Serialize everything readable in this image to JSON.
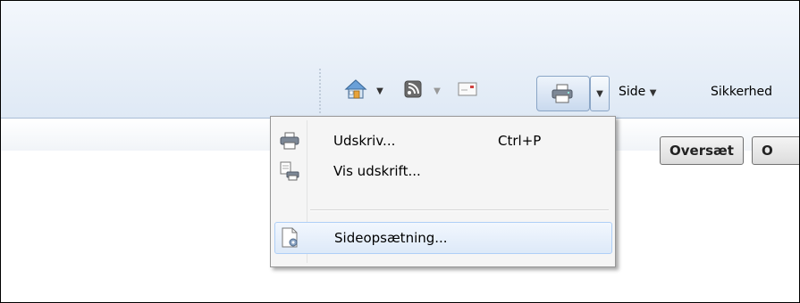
{
  "toolbar": {
    "home_icon": "home-icon",
    "feeds_icon": "feeds-icon",
    "mail_icon": "mail-icon",
    "print_icon": "printer-icon",
    "side_label": "Side",
    "security_label": "Sikkerhed"
  },
  "second_bar": {
    "translate_label": "Oversæt",
    "next_button_partial": "O"
  },
  "print_menu": {
    "items": [
      {
        "label": "Udskriv...",
        "shortcut": "Ctrl+P",
        "icon": "printer-icon"
      },
      {
        "label": "Vis udskrift...",
        "icon": "print-preview-icon"
      },
      {
        "label": "Sideopsætning...",
        "icon": "page-setup-icon",
        "highlighted": true
      }
    ]
  },
  "colors": {
    "toolbar_top": "#f3f7fc",
    "toolbar_bottom": "#dfe9f5",
    "menu_background": "#f5f5f5",
    "menu_highlight": "#dde9f8"
  }
}
